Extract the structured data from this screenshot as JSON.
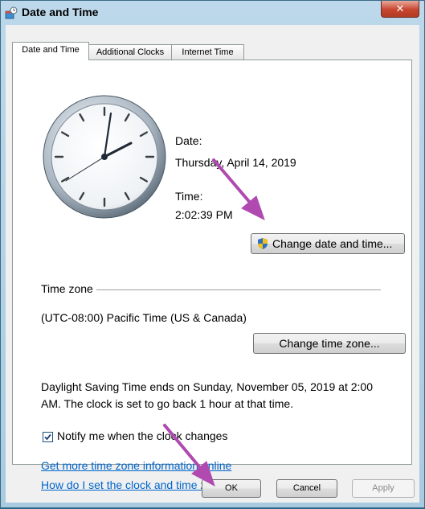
{
  "window": {
    "title": "Date and Time",
    "close_glyph": "✕"
  },
  "tabs": [
    {
      "label": "Date and Time"
    },
    {
      "label": "Additional Clocks"
    },
    {
      "label": "Internet Time"
    }
  ],
  "datetime": {
    "date_label": "Date:",
    "date_value": "Thursday, April 14, 2019",
    "time_label": "Time:",
    "time_value": "2:02:39 PM",
    "change_button": "Change date and time..."
  },
  "timezone": {
    "section_label": "Time zone",
    "value": "(UTC-08:00) Pacific Time (US & Canada)",
    "change_button": "Change time zone..."
  },
  "dst_text_line1": "Daylight Saving Time ends on Sunday, November 05, 2019 at 2:00",
  "dst_text_line2": "AM. The clock is set to go back 1 hour at that time.",
  "notify": {
    "label": "Notify me when the clock changes",
    "checked": true
  },
  "links": {
    "more_info": "Get more time zone information online",
    "how_to": "How do I set the clock and time zone?"
  },
  "footer": {
    "ok": "OK",
    "cancel": "Cancel",
    "apply": "Apply"
  },
  "icons": [
    "date-time-app-icon",
    "close-icon",
    "analog-clock-icon",
    "uac-shield-icon",
    "checkmark-icon",
    "arrow-annotation-icon"
  ],
  "colors": {
    "link": "#0066cc",
    "arrow": "#b04ab0",
    "close_button": "#c8462f"
  }
}
